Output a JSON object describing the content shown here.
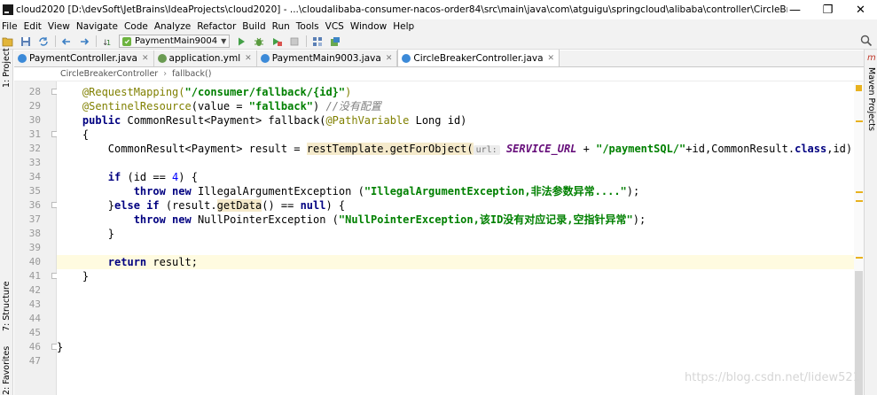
{
  "window": {
    "title": "cloud2020 [D:\\devSoft\\JetBrains\\IdeaProjects\\cloud2020] - ...\\cloudalibaba-consumer-nacos-order84\\src\\main\\java\\com\\atguigu\\springcloud\\alibaba\\controller\\CircleBreakerController.java [cloudalibaba-c...",
    "minimize": "—",
    "maximize": "❐",
    "close": "✕"
  },
  "menu": [
    "File",
    "Edit",
    "View",
    "Navigate",
    "Code",
    "Analyze",
    "Refactor",
    "Build",
    "Run",
    "Tools",
    "VCS",
    "Window",
    "Help"
  ],
  "toolbar": {
    "run_config": "PaymentMain9004"
  },
  "side_tabs": {
    "project": "1: Project",
    "structure": "7: Structure",
    "favorites": "2: Favorites",
    "maven": "Maven Projects",
    "m_badge": "m"
  },
  "tabs": [
    {
      "label": "PaymentController.java",
      "active": false,
      "icon_color": "#3c8ad8"
    },
    {
      "label": "application.yml",
      "active": false,
      "icon_color": "#6a9b52"
    },
    {
      "label": "PaymentMain9003.java",
      "active": false,
      "icon_color": "#3c8ad8"
    },
    {
      "label": "CircleBreakerController.java",
      "active": true,
      "icon_color": "#3c8ad8"
    }
  ],
  "breadcrumb": [
    "CircleBreakerController",
    "fallback()"
  ],
  "editor": {
    "caret_line": 40,
    "lines": [
      {
        "num": "28",
        "parts": [
          [
            "",
            "    "
          ],
          [
            "ann",
            "@RequestMapping("
          ],
          [
            "str",
            "\"/consumer/fallback/{id}\""
          ],
          [
            "ann",
            ")"
          ]
        ]
      },
      {
        "num": "29",
        "parts": [
          [
            "",
            "    "
          ],
          [
            "ann",
            "@SentinelResource"
          ],
          [
            "",
            "(value = "
          ],
          [
            "str",
            "\"fallback\""
          ],
          [
            "",
            ") "
          ],
          [
            "cmt",
            "//没有配置"
          ]
        ]
      },
      {
        "num": "30",
        "parts": [
          [
            "",
            "    "
          ],
          [
            "kw",
            "public"
          ],
          [
            "",
            " CommonResult<Payment> fallback("
          ],
          [
            "ann",
            "@PathVariable"
          ],
          [
            "",
            " Long id)"
          ]
        ]
      },
      {
        "num": "31",
        "parts": [
          [
            "",
            "    {"
          ]
        ]
      },
      {
        "num": "32",
        "parts": [
          [
            "",
            "        CommonResult<Payment> result = "
          ],
          [
            "rt-hl",
            "restTemplate.getForObject("
          ],
          [
            "hint",
            "url:"
          ],
          [
            "",
            " "
          ],
          [
            "cst",
            "SERVICE_URL"
          ],
          [
            "",
            " + "
          ],
          [
            "str",
            "\"/paymentSQL/\""
          ],
          [
            "",
            "+id,CommonResult."
          ],
          [
            "kw",
            "class"
          ],
          [
            "",
            ",id);"
          ]
        ]
      },
      {
        "num": "33",
        "parts": [
          [
            "",
            ""
          ]
        ]
      },
      {
        "num": "34",
        "parts": [
          [
            "",
            "        "
          ],
          [
            "kw",
            "if"
          ],
          [
            "",
            " (id == "
          ],
          [
            "num",
            "4"
          ],
          [
            "",
            ") {"
          ]
        ]
      },
      {
        "num": "35",
        "parts": [
          [
            "",
            "            "
          ],
          [
            "kw",
            "throw new"
          ],
          [
            "",
            " IllegalArgumentException ("
          ],
          [
            "str",
            "\"IllegalArgumentException,非法参数异常....\""
          ],
          [
            "",
            ");"
          ]
        ]
      },
      {
        "num": "36",
        "parts": [
          [
            "",
            "        }"
          ],
          [
            "kw",
            "else if"
          ],
          [
            "",
            " (result."
          ],
          [
            "rt-hl",
            "getData"
          ],
          [
            "",
            "() == "
          ],
          [
            "kw",
            "null"
          ],
          [
            "",
            ") {"
          ]
        ]
      },
      {
        "num": "37",
        "parts": [
          [
            "",
            "            "
          ],
          [
            "kw",
            "throw new"
          ],
          [
            "",
            " NullPointerException ("
          ],
          [
            "str",
            "\"NullPointerException,该ID没有对应记录,空指针异常\""
          ],
          [
            "",
            ");"
          ]
        ]
      },
      {
        "num": "38",
        "parts": [
          [
            "",
            "        }"
          ]
        ]
      },
      {
        "num": "39",
        "parts": [
          [
            "",
            ""
          ]
        ]
      },
      {
        "num": "40",
        "parts": [
          [
            "",
            "        "
          ],
          [
            "kw",
            "return"
          ],
          [
            "",
            " result;"
          ]
        ]
      },
      {
        "num": "41",
        "parts": [
          [
            "",
            "    }"
          ]
        ]
      },
      {
        "num": "42",
        "parts": [
          [
            "",
            ""
          ]
        ]
      },
      {
        "num": "43",
        "parts": [
          [
            "",
            ""
          ]
        ]
      },
      {
        "num": "44",
        "parts": [
          [
            "",
            ""
          ]
        ]
      },
      {
        "num": "45",
        "parts": [
          [
            "",
            ""
          ]
        ]
      },
      {
        "num": "46",
        "parts": [
          [
            "",
            "}"
          ]
        ]
      },
      {
        "num": "47",
        "parts": [
          [
            "",
            ""
          ]
        ]
      }
    ]
  },
  "watermark": "https://blog.csdn.net/lidew521"
}
